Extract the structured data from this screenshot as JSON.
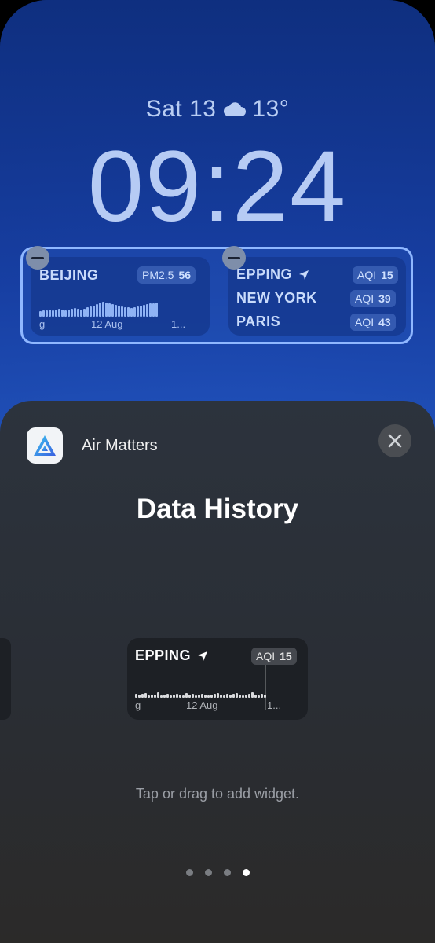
{
  "lock_screen": {
    "date": "Sat 13",
    "temperature": "13°",
    "weather_icon": "cloud-icon",
    "time": "09:24"
  },
  "widgets": {
    "left": {
      "city": "BEIJING",
      "metric_label": "PM2.5",
      "metric_value": "56",
      "axis_labels": [
        "g",
        "12 Aug",
        "1..."
      ]
    },
    "right": {
      "locations": [
        {
          "city": "EPPING",
          "metric_label": "AQI",
          "metric_value": "15",
          "current_location": true
        },
        {
          "city": "NEW YORK",
          "metric_label": "AQI",
          "metric_value": "39"
        },
        {
          "city": "PARIS",
          "metric_label": "AQI",
          "metric_value": "43"
        }
      ]
    }
  },
  "sheet": {
    "app_name": "Air Matters",
    "title": "Data History",
    "preview": {
      "city": "EPPING",
      "metric_label": "AQI",
      "metric_value": "15",
      "axis_labels": [
        "g",
        "12 Aug",
        "1..."
      ]
    },
    "hint": "Tap or drag to add widget.",
    "page_count": 4,
    "active_page": 4
  },
  "colors": {
    "accent_blue": "#8fb7ff",
    "sheet_bg": "#2a2e35"
  }
}
